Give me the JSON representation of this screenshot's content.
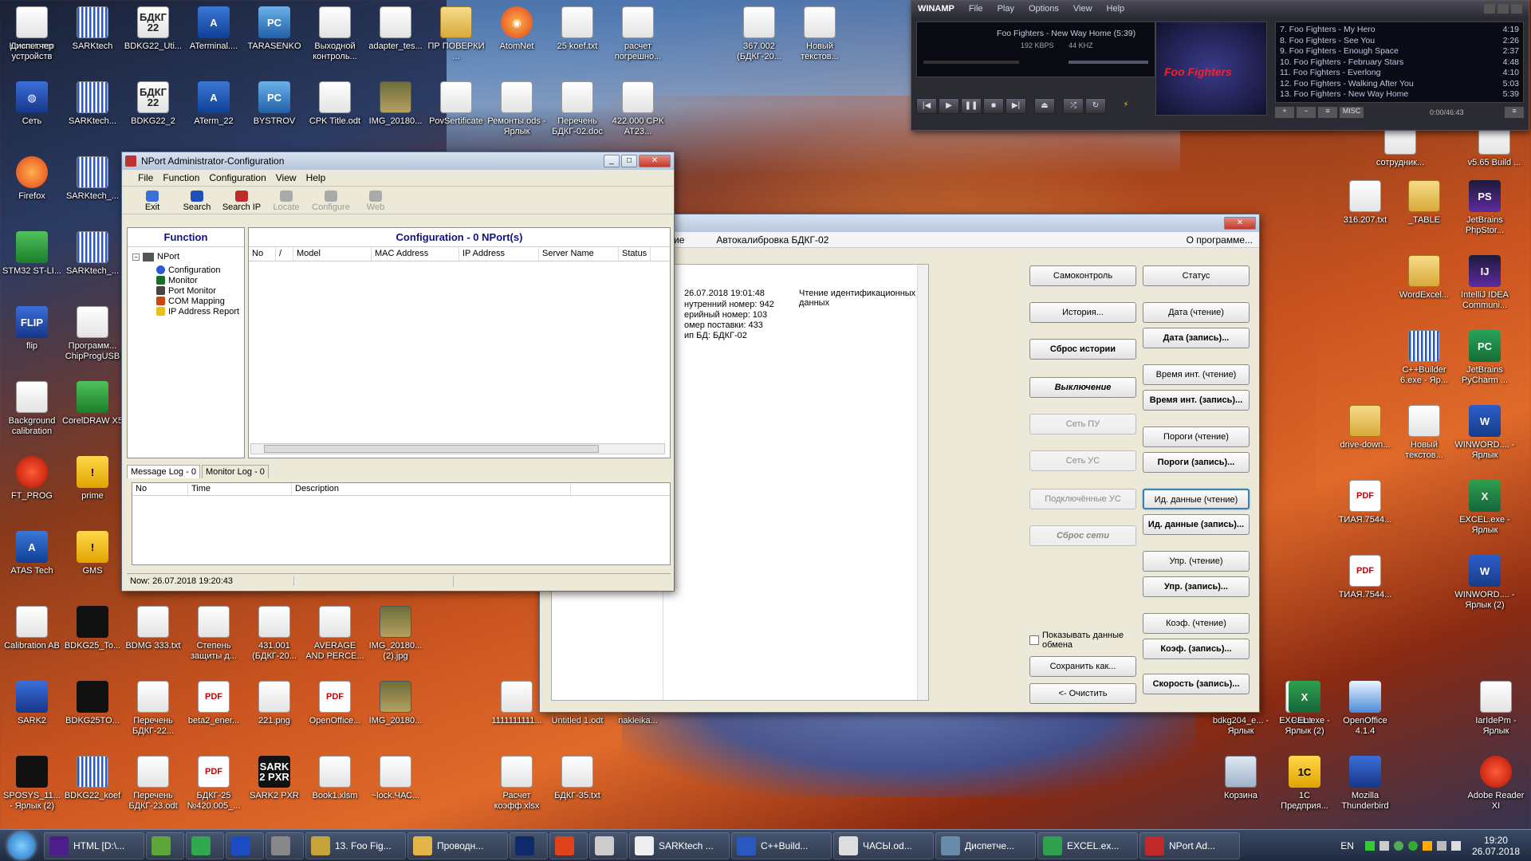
{
  "desktop": {
    "icons": [
      {
        "label": "Компьютер",
        "glyph": "PC",
        "style": "g-pc"
      },
      {
        "label": "SARKtech",
        "glyph": "",
        "style": "g-grid"
      },
      {
        "label": "BDKG22_Uti...",
        "glyph": "БДКГ 22",
        "style": "g-doc"
      },
      {
        "label": "ATerminal....",
        "glyph": "A",
        "style": "g-tri"
      },
      {
        "label": "TARASENKO",
        "glyph": "PC",
        "style": "g-pc"
      },
      {
        "label": "Выходной контроль...",
        "glyph": "",
        "style": "g-doc"
      },
      {
        "label": "adapter_tes...",
        "glyph": "",
        "style": "g-doc"
      },
      {
        "label": "ПР ПОВЕРКИ ...",
        "glyph": "",
        "style": "g-folder"
      },
      {
        "label": "AtomNet",
        "glyph": "◉",
        "style": "g-ff"
      },
      {
        "label": "25 koef.txt",
        "glyph": "",
        "style": "g-doc"
      },
      {
        "label": "расчет погрешно...",
        "glyph": "",
        "style": "g-doc"
      },
      {
        "label": "367.002 (БДКГ-20...",
        "glyph": "",
        "style": "g-doc"
      },
      {
        "label": "Новый текстов...",
        "glyph": "",
        "style": "g-doc"
      },
      {
        "label": "Сеть",
        "glyph": "◍",
        "style": "g-blue"
      },
      {
        "label": "SARKtech...",
        "glyph": "",
        "style": "g-grid"
      },
      {
        "label": "BDKG22_2",
        "glyph": "БДКГ 22",
        "style": "g-doc"
      },
      {
        "label": "ATerm_22",
        "glyph": "A",
        "style": "g-tri"
      },
      {
        "label": "BYSTROV",
        "glyph": "PC",
        "style": "g-pc"
      },
      {
        "label": "CPK Title.odt",
        "glyph": "",
        "style": "g-doc"
      },
      {
        "label": "IMG_20180...",
        "glyph": "",
        "style": "g-pic"
      },
      {
        "label": "PovSertificate",
        "glyph": "",
        "style": "g-doc"
      },
      {
        "label": "Ремонты.ods - Ярлык",
        "glyph": "",
        "style": "g-doc"
      },
      {
        "label": "Перечень БДКГ-02.doc",
        "glyph": "",
        "style": "g-doc"
      },
      {
        "label": "422.000 СРК АТ23...",
        "glyph": "",
        "style": "g-doc"
      },
      {
        "label": "Firefox",
        "glyph": "",
        "style": "g-ff"
      },
      {
        "label": "SARKtech_...",
        "glyph": "",
        "style": "g-grid"
      },
      {
        "label": "STM32 ST-LI...",
        "glyph": "",
        "style": "g-green"
      },
      {
        "label": "SARKtech_...",
        "glyph": "",
        "style": "g-grid"
      },
      {
        "label": "flip",
        "glyph": "FLIP",
        "style": "g-blue"
      },
      {
        "label": "Программ... ChipProgUSB",
        "glyph": "",
        "style": "g-doc"
      },
      {
        "label": "Background calibration",
        "glyph": "",
        "style": "g-doc"
      },
      {
        "label": "CorelDRAW X5",
        "glyph": "",
        "style": "g-green"
      },
      {
        "label": "FT_PROG",
        "glyph": "",
        "style": "g-red"
      },
      {
        "label": "prime",
        "glyph": "!",
        "style": "g-warn"
      },
      {
        "label": "ATAS Tech",
        "glyph": "A",
        "style": "g-tri"
      },
      {
        "label": "GMS",
        "glyph": "!",
        "style": "g-warn"
      },
      {
        "label": "Calibration AB",
        "glyph": "",
        "style": "g-doc"
      },
      {
        "label": "BDKG25_To...",
        "glyph": "",
        "style": "g-dark"
      },
      {
        "label": "BDMG 333.txt",
        "glyph": "",
        "style": "g-doc"
      },
      {
        "label": "Степень защиты д...",
        "glyph": "",
        "style": "g-doc"
      },
      {
        "label": "431.001 (БДКГ-20...",
        "glyph": "",
        "style": "g-doc"
      },
      {
        "label": "AVERAGE AND PERCE...",
        "glyph": "",
        "style": "g-doc"
      },
      {
        "label": "IMG_20180... (2).jpg",
        "glyph": "",
        "style": "g-pic"
      },
      {
        "label": "SARK2",
        "glyph": "",
        "style": "g-blue"
      },
      {
        "label": "BDKG25TO...",
        "glyph": "",
        "style": "g-dark"
      },
      {
        "label": "Перечень БДКГ-22...",
        "glyph": "",
        "style": "g-doc"
      },
      {
        "label": "beta2_ener...",
        "glyph": "PDF",
        "style": "g-pdf"
      },
      {
        "label": "221.png",
        "glyph": "",
        "style": "g-doc"
      },
      {
        "label": "OpenOffice...",
        "glyph": "PDF",
        "style": "g-pdf"
      },
      {
        "label": "IMG_20180...",
        "glyph": "",
        "style": "g-pic"
      },
      {
        "label": "1111111111...",
        "glyph": "",
        "style": "g-doc"
      },
      {
        "label": "Untitled 1.odt",
        "glyph": "",
        "style": "g-doc"
      },
      {
        "label": "nakleika...",
        "glyph": "",
        "style": "g-doc"
      },
      {
        "label": "SPOSYS_11... - Ярлык (2)",
        "glyph": "",
        "style": "g-dark"
      },
      {
        "label": "BDKG22_koef",
        "glyph": "",
        "style": "g-grid"
      },
      {
        "label": "Перечень БДКГ-23.odt",
        "glyph": "",
        "style": "g-doc"
      },
      {
        "label": "БДКГ-25 №420.005_...",
        "glyph": "PDF",
        "style": "g-pdf"
      },
      {
        "label": "SARK2 PXR",
        "glyph": "SARK 2 PXR",
        "style": "g-dark"
      },
      {
        "label": "Book1.xlsm",
        "glyph": "",
        "style": "g-doc"
      },
      {
        "label": "~lock.ЧАС...",
        "glyph": "",
        "style": "g-doc"
      },
      {
        "label": "Расчет коэфф.xlsx",
        "glyph": "",
        "style": "g-doc"
      },
      {
        "label": "БДКГ-35.txt",
        "glyph": "",
        "style": "g-doc"
      },
      {
        "label": "bdkg204_e... - Ярлык",
        "glyph": "",
        "style": "g-doc"
      },
      {
        "label": "Paint",
        "glyph": "",
        "style": "g-doc"
      },
      {
        "label": "сотрудник...",
        "glyph": "",
        "style": "g-doc"
      },
      {
        "label": "v5.65 Build ...",
        "glyph": "",
        "style": "g-doc"
      },
      {
        "label": "316.207.txt",
        "glyph": "",
        "style": "g-doc"
      },
      {
        "label": "_TABLE",
        "glyph": "",
        "style": "g-folder"
      },
      {
        "label": "JetBrains PhpStor...",
        "glyph": "PS",
        "style": "g-ps"
      },
      {
        "label": "WordExcel...",
        "glyph": "",
        "style": "g-folder"
      },
      {
        "label": "IntelliJ IDEA Communi...",
        "glyph": "IJ",
        "style": "g-ps"
      },
      {
        "label": "C++Builder 6.exe - Яр...",
        "glyph": "",
        "style": "g-grid"
      },
      {
        "label": "JetBrains PyCharm ...",
        "glyph": "PC",
        "style": "g-pc2"
      },
      {
        "label": "drive-down...",
        "glyph": "",
        "style": "g-folder"
      },
      {
        "label": "Новый текстов...",
        "glyph": "",
        "style": "g-doc"
      },
      {
        "label": "WINWORD.... - Ярлык",
        "glyph": "W",
        "style": "g-word"
      },
      {
        "label": "ТИАЯ.7544...",
        "glyph": "PDF",
        "style": "g-pdf"
      },
      {
        "label": "EXCEL.exe - Ярлык",
        "glyph": "X",
        "style": "g-excel"
      },
      {
        "label": "ТИАЯ.7544...",
        "glyph": "PDF",
        "style": "g-pdf"
      },
      {
        "label": "WINWORD.... - Ярлык (2)",
        "glyph": "W",
        "style": "g-word"
      },
      {
        "label": "EXCEL.exe - Ярлык (2)",
        "glyph": "X",
        "style": "g-excel"
      },
      {
        "label": "OpenOffice 4.1.4",
        "glyph": "",
        "style": "g-oo"
      },
      {
        "label": "IarIdePm - Ярлык",
        "glyph": "",
        "style": "g-doc"
      },
      {
        "label": "Корзина",
        "glyph": "",
        "style": "g-bin"
      },
      {
        "label": "1С Предприя...",
        "glyph": "1С",
        "style": "g-warn"
      },
      {
        "label": "Mozilla Thunderbird",
        "glyph": "",
        "style": "g-blue"
      },
      {
        "label": "Adobe Reader XI",
        "glyph": "",
        "style": "g-red"
      },
      {
        "label": "Диспетчер устройств",
        "glyph": "",
        "style": "g-doc"
      }
    ]
  },
  "winamp": {
    "menu": [
      "WINAMP",
      "File",
      "Play",
      "Options",
      "View",
      "Help"
    ],
    "track": "Foo Fighters - New Way Home (5:39)",
    "bitrate": "192",
    "bitrate_unit": "KBPS",
    "samplerate": "44",
    "samplerate_unit": "KHZ",
    "album_text": "Foo Fighters",
    "time": "0:00/46:43",
    "playlist": [
      {
        "title": "7. Foo Fighters - My Hero",
        "len": "4:19"
      },
      {
        "title": "8. Foo Fighters - See You",
        "len": "2:26"
      },
      {
        "title": "9. Foo Fighters - Enough Space",
        "len": "2:37"
      },
      {
        "title": "10. Foo Fighters - February Stars",
        "len": "4:48"
      },
      {
        "title": "11. Foo Fighters - Everlong",
        "len": "4:10"
      },
      {
        "title": "12. Foo Fighters - Walking After You",
        "len": "5:03"
      },
      {
        "title": "13. Foo Fighters - New Way Home",
        "len": "5:39"
      }
    ],
    "pl_buttons": [
      "+",
      "−",
      "≡",
      "MISC",
      "≡"
    ]
  },
  "nport": {
    "title": "NPort Administrator-Configuration",
    "menu": [
      "File",
      "Function",
      "Configuration",
      "View",
      "Help"
    ],
    "toolbar": [
      "Exit",
      "Search",
      "Search IP",
      "Locate",
      "Configure",
      "Web"
    ],
    "function_header": "Function",
    "tree_root": "NPort",
    "tree_items": [
      "Configuration",
      "Monitor",
      "Port Monitor",
      "COM Mapping",
      "IP Address Report"
    ],
    "config_header": "Configuration - 0 NPort(s)",
    "columns": [
      "No",
      "/",
      "Model",
      "MAC Address",
      "IP Address",
      "Server Name",
      "Status"
    ],
    "log_tabs": [
      "Message Log - 0",
      "Monitor Log - 0"
    ],
    "log_columns": [
      "No",
      "Time",
      "Description"
    ],
    "status_now": "Now: 26.07.2018 19:20:43"
  },
  "calib": {
    "menu_left": "ие",
    "menu_mid": "Автокалибровка БДКГ-02",
    "menu_right": "О программе...",
    "log_lines": [
      "26.07.2018 19:01:48",
      "Чтение идентификационных данных",
      "нутренний номер: 942",
      "ерийный номер: 103",
      "омер поставки: 433",
      "ип БД: БДКГ-02"
    ],
    "left_buttons": [
      "Самоконтроль",
      "История...",
      "Сброс истории",
      "Выключение",
      "Сеть ПУ",
      "Сеть УС",
      "Подключённые УС",
      "Сброс сети"
    ],
    "right_buttons": [
      "Статус",
      "Дата (чтение)",
      "Дата (запись)...",
      "Время инт. (чтение)",
      "Время инт. (запись)...",
      "Пороги (чтение)",
      "Пороги (запись)...",
      "Ид. данные (чтение)",
      "Ид. данные (запись)...",
      "Упр. (чтение)",
      "Упр. (запись)...",
      "Коэф. (чтение)",
      "Коэф. (запись)...",
      "Скорость (запись)..."
    ],
    "checkbox_label": "Показывать данные обмена",
    "save_button": "Сохранить как...",
    "clear_button": "<- Очистить"
  },
  "taskbar": {
    "items": [
      {
        "label": "HTML [D:\\...",
        "color": "#4b1e8a"
      },
      {
        "label": "",
        "color": "#5ea63a"
      },
      {
        "label": "",
        "color": "#2fa84f"
      },
      {
        "label": "",
        "color": "#1c4cc4"
      },
      {
        "label": "",
        "color": "#888888"
      },
      {
        "label": "13. Foo Fig...",
        "color": "#c8a23a"
      },
      {
        "label": "Проводн...",
        "color": "#e5b54a"
      },
      {
        "label": "",
        "color": "#0f2a6a"
      },
      {
        "label": "",
        "color": "#e0431b"
      },
      {
        "label": "",
        "color": "#cccccc"
      },
      {
        "label": "SARKtech ...",
        "color": "#eeeeee"
      },
      {
        "label": "C++Build...",
        "color": "#2b58c0"
      },
      {
        "label": "ЧАСЫ.od...",
        "color": "#dddddd"
      },
      {
        "label": "Диспетче...",
        "color": "#6a8aaa"
      },
      {
        "label": "EXCEL.ex...",
        "color": "#2ea04e"
      },
      {
        "label": "NPort Ad...",
        "color": "#c02a2a"
      }
    ],
    "lang": "EN",
    "time": "19:20",
    "date": "26.07.2018"
  }
}
